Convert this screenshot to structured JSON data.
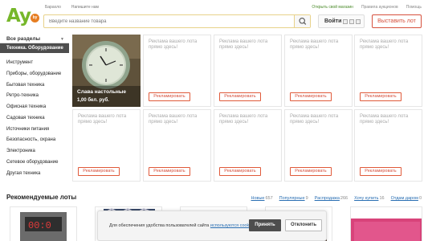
{
  "header": {
    "top_links_left": [
      "Барахло",
      "Напишите нам"
    ],
    "top_links_right": [
      "Открыть свой магазин",
      "Правила аукционов",
      "Помощь"
    ],
    "logo_text": "Ay",
    "logo_badge": "by",
    "search_placeholder": "Введите название товара",
    "login_label": "Войти",
    "sell_button": "Выставить лот",
    "colors": {
      "brand_green": "#76b72a",
      "brand_orange": "#e67e22",
      "accent_red": "#d6503c"
    }
  },
  "sidebar": {
    "header": "Все разделы",
    "active": "Техника. Оборудование",
    "items": [
      "Инструмент",
      "Приборы, оборудование",
      "Бытовая техника",
      "Ретро-техника",
      "Офисная техника",
      "Садовая техника",
      "Источники питания",
      "Безопасность, охрана",
      "Электроника",
      "Сетевое оборудование",
      "Другая техника"
    ]
  },
  "featured_lot": {
    "title": "Слава настольные",
    "price": "1,00 бел. руб."
  },
  "ad_slot": {
    "text": "Реклама вашего лота прямо здесь!",
    "button": "Рекламировать"
  },
  "recommended": {
    "title": "Рекомендуемые лоты",
    "tabs": [
      {
        "label": "Новые",
        "count": "657"
      },
      {
        "label": "Популярные",
        "count": "9"
      },
      {
        "label": "Распродажа",
        "count": "266"
      },
      {
        "label": "Хочу купить",
        "count": "16"
      },
      {
        "label": "Отдам даром",
        "count": "0"
      }
    ],
    "thumb_icons": [
      "clock-thumb",
      "fabric-thumb",
      "item-thumb",
      "item-thumb",
      "tile-thumb",
      "pink-item-thumb"
    ]
  },
  "cookie_banner": {
    "message": "Для обеспечения удобства пользователей сайта",
    "link": "используются cookies.",
    "accept": "Принять",
    "reject": "Отклонить"
  }
}
